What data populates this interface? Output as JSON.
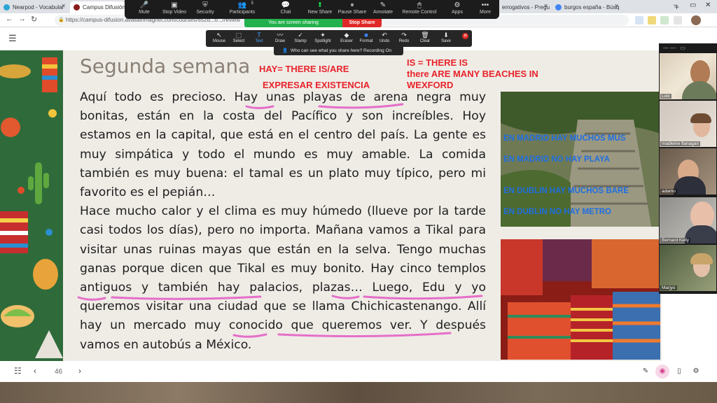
{
  "browser": {
    "tabs": [
      {
        "label": "Nearpod - Vocabular",
        "color": "#2aa6d5"
      },
      {
        "label": "Campus Difusión",
        "color": "#8a1c1c"
      },
      {
        "label": "errogativos - Pregu",
        "color": "#4285f4"
      },
      {
        "label": "burgos españa - Búsq",
        "color": "#4285f4"
      }
    ],
    "url": "https://campus-difusion.avallainmagnet.com/courses/652d...o.../review"
  },
  "zoom_toolbar": {
    "buttons": [
      {
        "label": "Mute",
        "icon": "🎤"
      },
      {
        "label": "Stop Video",
        "icon": "▣"
      },
      {
        "label": "Security",
        "icon": "⛨"
      },
      {
        "label": "Participants",
        "icon": "👥",
        "count": "5"
      },
      {
        "label": "Chat",
        "icon": "💬"
      },
      {
        "label": "New Share",
        "icon": "⬆"
      },
      {
        "label": "Pause Share",
        "icon": "⏸"
      },
      {
        "label": "Annotate",
        "icon": "✎"
      },
      {
        "label": "Remote Control",
        "icon": "🖱"
      },
      {
        "label": "Apps",
        "icon": "⚙"
      },
      {
        "label": "More",
        "icon": "•••"
      }
    ],
    "sharing_label": "You are screen sharing",
    "stop_share_label": "Stop Share"
  },
  "annotate_toolbar": {
    "tools": [
      {
        "label": "Mouse",
        "icon": "↖"
      },
      {
        "label": "Select",
        "icon": "⬚"
      },
      {
        "label": "Text",
        "icon": "T"
      },
      {
        "label": "Draw",
        "icon": "〰"
      },
      {
        "label": "Stamp",
        "icon": "✓"
      },
      {
        "label": "Spotlight",
        "icon": "✦"
      },
      {
        "label": "Eraser",
        "icon": "◆"
      },
      {
        "label": "Format",
        "icon": "■"
      },
      {
        "label": "Undo",
        "icon": "↶"
      },
      {
        "label": "Redo",
        "icon": "↷"
      },
      {
        "label": "Clear",
        "icon": "🗑"
      },
      {
        "label": "Save",
        "icon": "⬇"
      }
    ],
    "selected": "Text",
    "recording_note": "Who can see what you share here? Recording On"
  },
  "slide": {
    "title": "Segunda semana",
    "paragraphs": [
      "Aquí todo es precioso. Hay unas playas de arena negra muy bonitas, están en la costa del Pacífico y son increíbles. Hoy estamos en la capital, que está en el centro del país. La gente es muy simpática y todo el mundo es muy amable. La comida también es muy buena: el tamal es un plato muy típico, pero mi favorito es el pepián…",
      "Hace mucho calor y el clima es muy húmedo (llueve por la tarde casi todos los días), pero no importa. Mañana vamos a Tikal para visitar unas ruinas mayas que están en la selva. Tengo muchas ganas porque dicen que Tikal es muy bonito. Hay cinco templos antiguos y también hay palacios, plazas… Luego, Edu y yo queremos visitar una ciudad que se llama Chichicastenango. Allí hay un mercado muy conocido que queremos ver. Y después vamos en autobús a México."
    ],
    "annotations_red": [
      "HAY= THERE IS/ARE",
      "EXPRESAR EXISTENCIA",
      "IS = THERE IS",
      "there ARE MANY BEACHES IN",
      "WEXFORD"
    ],
    "annotations_blue": [
      "EN MADRID HAY MUCHOS MUS",
      "EN MADRID NO HAY PLAYA",
      "EN DUBLIN HAY MUCHOS BARE",
      "EN DUBLIN NO HAY METRO"
    ]
  },
  "participants": [
    {
      "name": "Loic"
    },
    {
      "name": "madleine flanagan"
    },
    {
      "name": "adamo"
    },
    {
      "name": "Bernard Kelly"
    },
    {
      "name": "Marjyo"
    }
  ],
  "pager": {
    "page": "46"
  }
}
